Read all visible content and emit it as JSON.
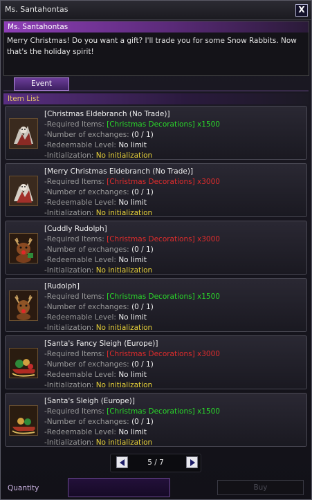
{
  "window": {
    "title": "Ms. Santahontas",
    "close_label": "X"
  },
  "npc": {
    "name": "Ms. Santahontas",
    "dialog": "Merry Christmas! Do you want a gift? I'll trade you for some Snow Rabbits. Now that's the holiday spirit!"
  },
  "tabs": [
    {
      "label": "Event",
      "active": true
    }
  ],
  "section_header": "Item List",
  "field_labels": {
    "required": "-Required Items:",
    "exchanges": "-Number of exchanges:",
    "level": "-Redeemable Level:",
    "init": "-Initialization:"
  },
  "items": [
    {
      "name": "[Christmas Eldebranch (No Trade)]",
      "required": "[Christmas Decorations] x1500",
      "required_status": "green",
      "exchanges": "(0 / 1)",
      "level": "No limit",
      "init": "No initialization",
      "icon": "eldebranch-icon"
    },
    {
      "name": "[Merry Christmas Eldebranch (No Trade)]",
      "required": "[Christmas Decorations] x3000",
      "required_status": "red",
      "exchanges": "(0 / 1)",
      "level": "No limit",
      "init": "No initialization",
      "icon": "eldebranch-icon"
    },
    {
      "name": "[Cuddly Rudolph]",
      "required": "[Christmas Decorations] x3000",
      "required_status": "red",
      "exchanges": "(0 / 1)",
      "level": "No limit",
      "init": "No initialization",
      "icon": "reindeer-icon"
    },
    {
      "name": "[Rudolph]",
      "required": "[Christmas Decorations] x1500",
      "required_status": "green",
      "exchanges": "(0 / 1)",
      "level": "No limit",
      "init": "No initialization",
      "icon": "reindeer-icon"
    },
    {
      "name": "[Santa's Fancy Sleigh (Europe)]",
      "required": "[Christmas Decorations] x3000",
      "required_status": "red",
      "exchanges": "(0 / 1)",
      "level": "No limit",
      "init": "No initialization",
      "icon": "sleigh-icon"
    },
    {
      "name": "[Santa's Sleigh (Europe)]",
      "required": "[Christmas Decorations] x1500",
      "required_status": "green",
      "exchanges": "(0 / 1)",
      "level": "No limit",
      "init": "No initialization",
      "icon": "sleigh-icon"
    }
  ],
  "pager": {
    "text": "5 / 7"
  },
  "quantity": {
    "label": "Quantity",
    "value": ""
  },
  "buy_button": {
    "label": "Buy",
    "enabled": false
  },
  "colors": {
    "green": "#2ad82a",
    "red": "#e02c2c",
    "yellow": "#e8d23a",
    "accent_purple": "#8e3fb7"
  }
}
